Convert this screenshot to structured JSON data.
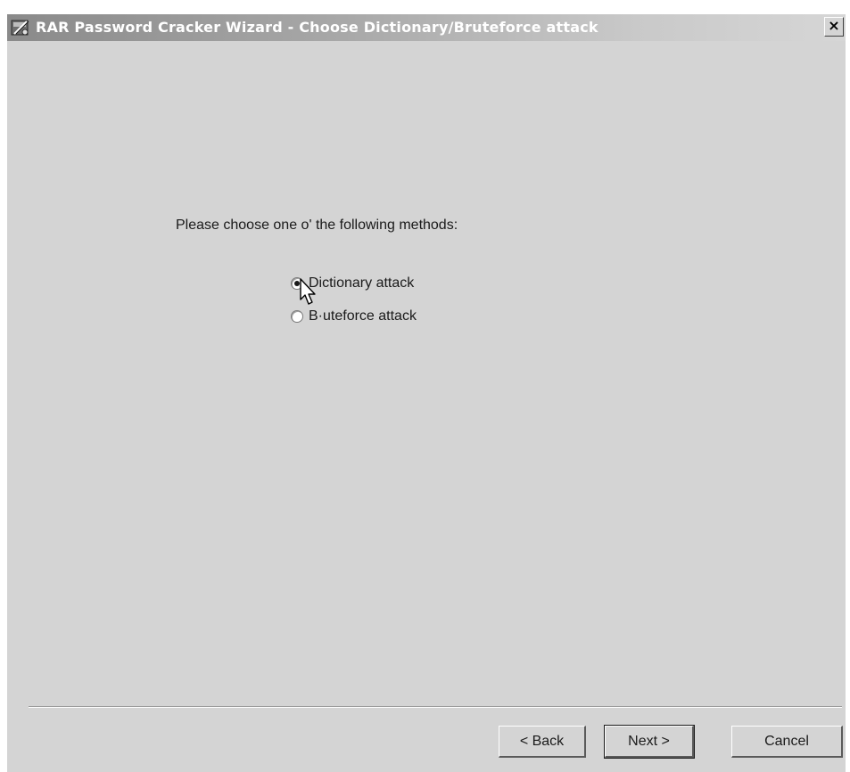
{
  "window": {
    "title": "RAR Password Cracker Wizard - Choose Dictionary/Bruteforce attack",
    "close_label": "×"
  },
  "main": {
    "prompt": "Please choose one o' the following methods:",
    "options": [
      {
        "label": "Dictionary attack",
        "selected": true
      },
      {
        "label": "B·uteforce attack",
        "selected": false
      }
    ]
  },
  "footer": {
    "back_label": "< Back",
    "next_label": "Next >",
    "cancel_label": "Cancel"
  },
  "icons": {
    "app": "rar-cracker-icon",
    "cursor": "mouse-pointer-icon",
    "close": "close-icon"
  }
}
